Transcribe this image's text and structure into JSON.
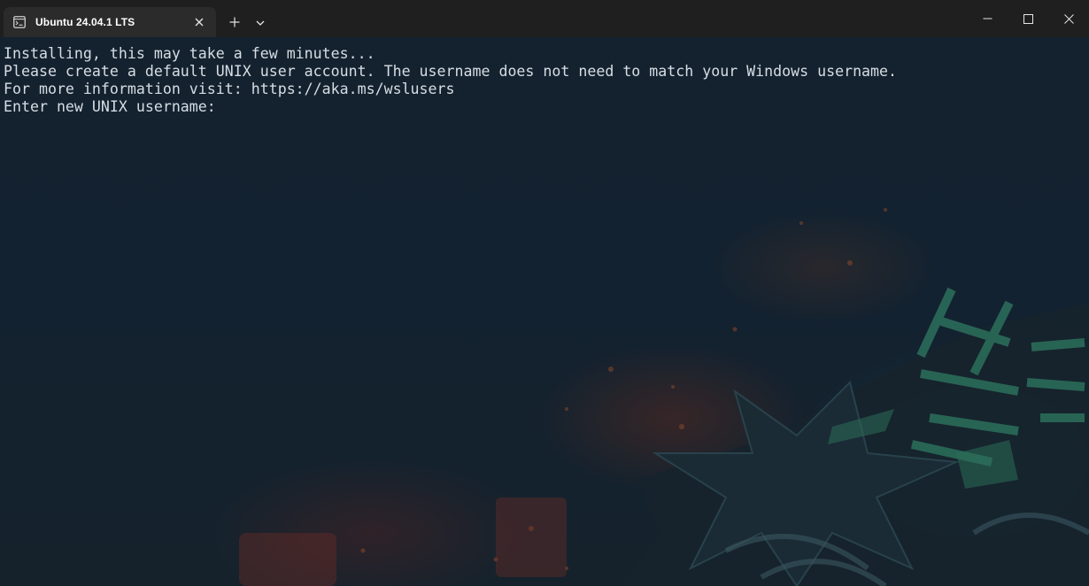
{
  "window": {
    "tab_title": "Ubuntu 24.04.1 LTS",
    "tab_icon": "terminal-icon",
    "new_tab_icon": "plus-icon",
    "dropdown_icon": "chevron-down-icon",
    "controls": [
      "minimize-icon",
      "maximize-icon",
      "close-icon"
    ]
  },
  "terminal": {
    "lines": [
      "Installing, this may take a few minutes...",
      "Please create a default UNIX user account. The username does not need to match your Windows username.",
      "For more information visit: https://aka.ms/wslusers",
      "Enter new UNIX username: "
    ],
    "text_color": "#d7dde3",
    "background_color": "#0f1a25"
  }
}
